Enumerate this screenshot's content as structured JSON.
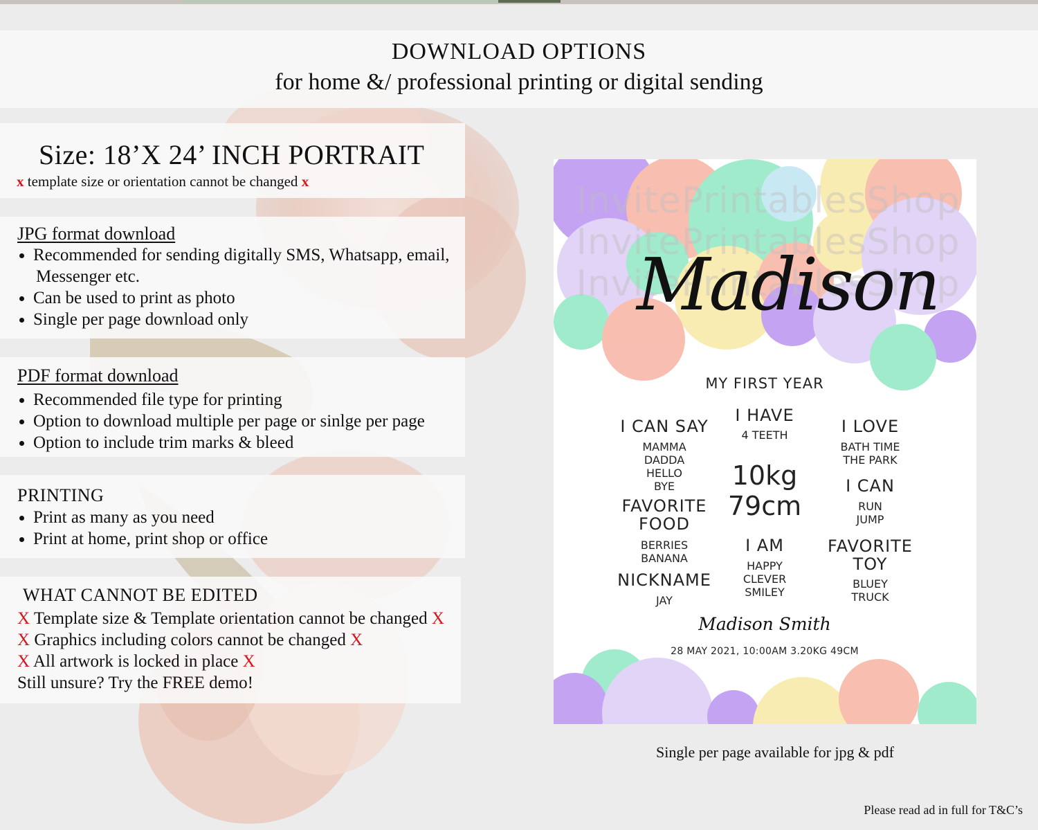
{
  "header": {
    "title": "DOWNLOAD OPTIONS",
    "subtitle": "for home &/ professional printing or digital sending"
  },
  "size_panel": {
    "title": "Size: 18’X 24’ INCH PORTRAIT",
    "mark": "x",
    "note": "template size or orientation cannot be changed"
  },
  "jpg_panel": {
    "title": "JPG format download",
    "items": [
      "Recommended for sending digitally SMS, Whatsapp, email,",
      "Messenger etc.",
      "Can be used to print as photo",
      "Single per page download only"
    ]
  },
  "pdf_panel": {
    "title": "PDF format download",
    "items": [
      "Recommended file type for printing",
      "Option to download multiple per page or sinlge per page",
      "Option to include trim marks & bleed"
    ]
  },
  "printing_panel": {
    "title": "PRINTING",
    "items": [
      "Print as many as you need",
      "Print at home, print shop or office"
    ]
  },
  "edit_panel": {
    "title": "WHAT CANNOT BE EDITED",
    "mark": "X",
    "lines": [
      "Template size & Template orientation cannot be changed",
      "Graphics including colors cannot be changed",
      "All artwork is locked in place"
    ],
    "closing": "Still unsure? Try the FREE demo!"
  },
  "poster": {
    "name": "Madison",
    "watermark": "InvitePrintablesShop",
    "heading": "MY FIRST YEAR",
    "i_can_say": {
      "title": "I CAN SAY",
      "items": [
        "MAMMA",
        "DADDA",
        "HELLO",
        "BYE"
      ]
    },
    "i_have": {
      "title": "I HAVE",
      "value": "4 TEETH"
    },
    "i_love": {
      "title": "I LOVE",
      "items": [
        "BATH TIME",
        "THE PARK"
      ]
    },
    "weight": "10kg",
    "height": "79cm",
    "i_can": {
      "title": "I CAN",
      "items": [
        "RUN",
        "JUMP"
      ]
    },
    "favorite_food": {
      "title_1": "FAVORITE",
      "title_2": "FOOD",
      "items": [
        "BERRIES",
        "BANANA"
      ]
    },
    "i_am": {
      "title": "I AM",
      "items": [
        "HAPPY",
        "CLEVER",
        "SMILEY"
      ]
    },
    "favorite_toy": {
      "title_1": "FAVORITE",
      "title_2": "TOY",
      "items": [
        "BLUEY",
        "TRUCK"
      ]
    },
    "nickname": {
      "title": "NICKNAME",
      "value": "JAY"
    },
    "signature": "Madison Smith",
    "birth_details": "28 MAY 2021, 10:00AM 3.20KG 49CM",
    "colors": {
      "purple": "#b993f0",
      "lilac": "#dccdf5",
      "peach": "#f7b3a3",
      "mint": "#8fe8c2",
      "yellow": "#f8e9a5",
      "lightblue": "#bfe6f2"
    }
  },
  "caption": "Single per page available for jpg & pdf",
  "footnote": "Please read ad in full for T&C’s"
}
